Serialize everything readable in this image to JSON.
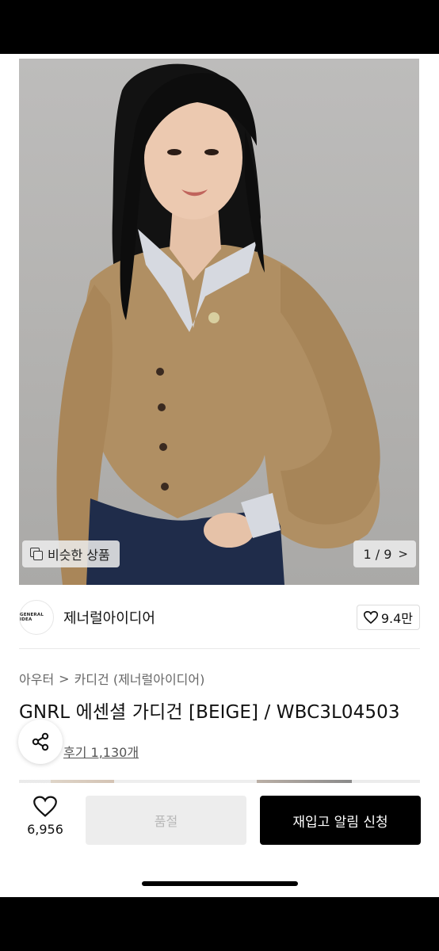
{
  "gallery": {
    "similar_label": "비슷한 상품",
    "page_current": "1",
    "page_separator": "/",
    "page_total": "9",
    "pager_arrow": ">"
  },
  "brand": {
    "logo_text": "GENERAL IDEA",
    "name": "제너럴아이디어",
    "likes": "9.4만"
  },
  "breadcrumb": {
    "category": "아우터",
    "separator": ">",
    "subcategory": "카디건 (제너럴아이디어)"
  },
  "product": {
    "title": "GNRL 에센셜 가디건 [BEIGE] / WBC3L04503",
    "review_link": "후기 1,130개"
  },
  "actions": {
    "wish_count": "6,956",
    "soldout_label": "품절",
    "notify_label": "재입고 알림 신청"
  },
  "icons": {
    "similar": "similar-products-icon",
    "heart": "heart-icon",
    "share": "share-icon"
  },
  "colors": {
    "primary_button": "#000000",
    "disabled_button": "#ededed",
    "cardigan": "#b08f63"
  }
}
